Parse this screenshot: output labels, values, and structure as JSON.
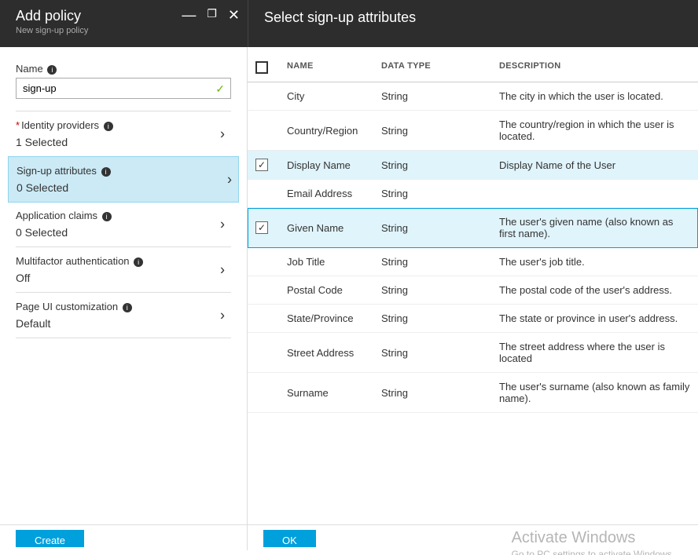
{
  "header": {
    "left_title": "Add policy",
    "left_subtitle": "New sign-up policy",
    "right_title": "Select sign-up attributes"
  },
  "name_field": {
    "label": "Name",
    "value": "sign-up"
  },
  "sections": [
    {
      "title": "Identity providers",
      "value": "1 Selected",
      "required": true,
      "selected": false
    },
    {
      "title": "Sign-up attributes",
      "value": "0 Selected",
      "required": false,
      "selected": true
    },
    {
      "title": "Application claims",
      "value": "0 Selected",
      "required": false,
      "selected": false
    },
    {
      "title": "Multifactor authentication",
      "value": "Off",
      "required": false,
      "selected": false
    },
    {
      "title": "Page UI customization",
      "value": "Default",
      "required": false,
      "selected": false
    }
  ],
  "attributes": {
    "headers": {
      "name": "NAME",
      "type": "DATA TYPE",
      "desc": "DESCRIPTION"
    },
    "rows": [
      {
        "name": "City",
        "type": "String",
        "desc": "The city in which the user is located.",
        "checked": false,
        "sel": ""
      },
      {
        "name": "Country/Region",
        "type": "String",
        "desc": "The country/region in which the user is located.",
        "checked": false,
        "sel": ""
      },
      {
        "name": "Display Name",
        "type": "String",
        "desc": "Display Name of the User",
        "checked": true,
        "sel": "soft"
      },
      {
        "name": "Email Address",
        "type": "String",
        "desc": "",
        "checked": false,
        "sel": ""
      },
      {
        "name": "Given Name",
        "type": "String",
        "desc": "The user's given name (also known as first name).",
        "checked": true,
        "sel": "hard"
      },
      {
        "name": "Job Title",
        "type": "String",
        "desc": "The user's job title.",
        "checked": false,
        "sel": ""
      },
      {
        "name": "Postal Code",
        "type": "String",
        "desc": "The postal code of the user's address.",
        "checked": false,
        "sel": ""
      },
      {
        "name": "State/Province",
        "type": "String",
        "desc": "The state or province in user's address.",
        "checked": false,
        "sel": ""
      },
      {
        "name": "Street Address",
        "type": "String",
        "desc": "The street address where the user is located",
        "checked": false,
        "sel": ""
      },
      {
        "name": "Surname",
        "type": "String",
        "desc": "The user's surname (also known as family name).",
        "checked": false,
        "sel": ""
      }
    ]
  },
  "footer": {
    "create_label": "Create",
    "ok_label": "OK"
  },
  "watermark": {
    "line1": "Activate Windows",
    "line2": "Go to PC settings to activate Windows."
  }
}
